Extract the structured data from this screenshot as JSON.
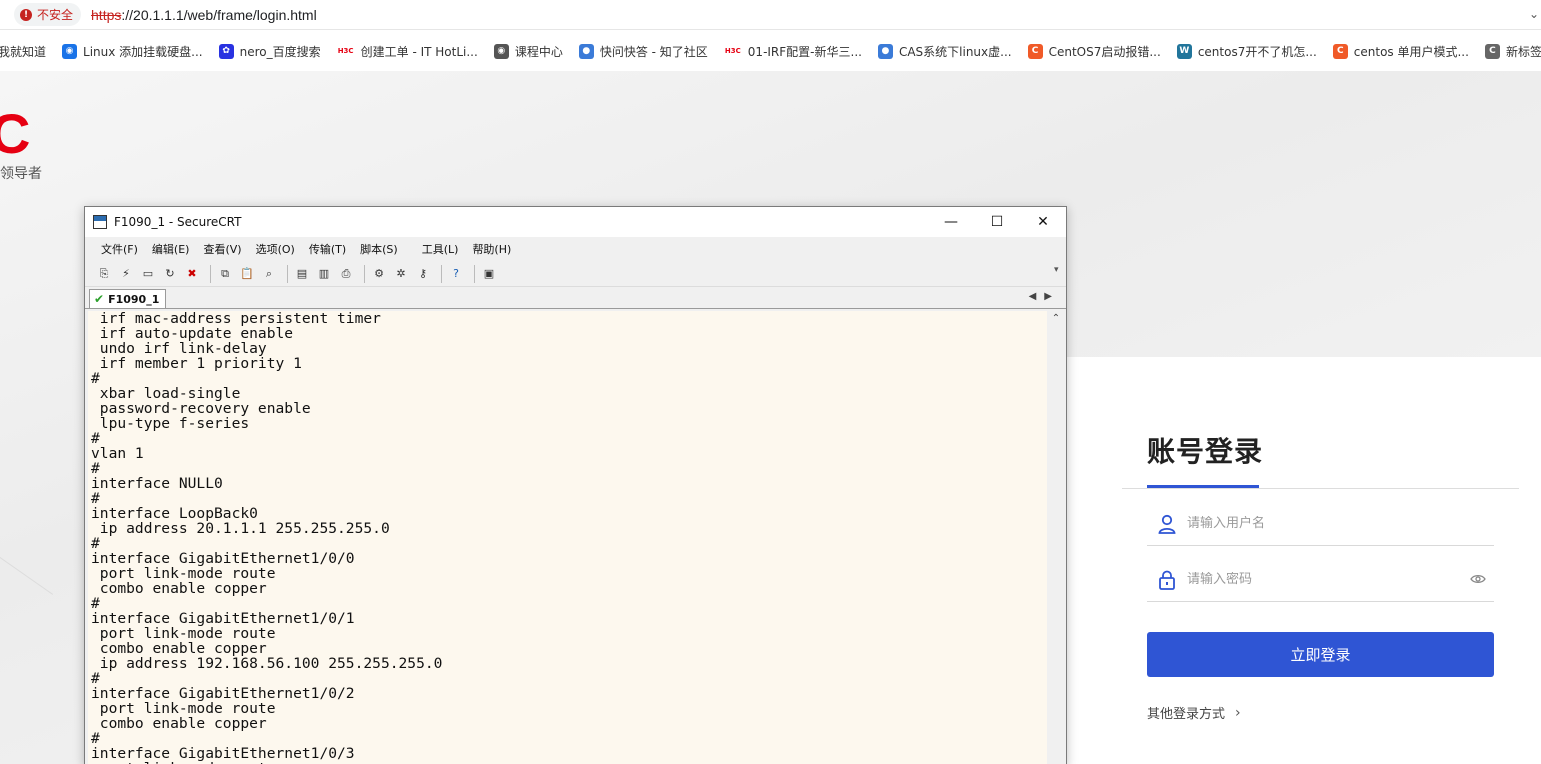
{
  "browser": {
    "security_label": "不安全",
    "url_scheme": "https",
    "url_rest": "://20.1.1.1/web/frame/login.html",
    "bookmarks": [
      {
        "label": "我就知道",
        "icon": "none",
        "color": "#ffffff"
      },
      {
        "label": "Linux 添加挂载硬盘...",
        "icon": "globe-icon",
        "color": "#1a73e8"
      },
      {
        "label": "nero_百度搜索",
        "icon": "paw-icon",
        "color": "#2932e1"
      },
      {
        "label": "创建工单 - IT HotLi...",
        "icon": "h3c-icon",
        "color": "#e60012"
      },
      {
        "label": "课程中心",
        "icon": "globe-icon",
        "color": "#555555"
      },
      {
        "label": "快问快答 - 知了社区",
        "icon": "drop-icon",
        "color": "#3b7bd8"
      },
      {
        "label": "01-IRF配置-新华三...",
        "icon": "h3c-icon",
        "color": "#e60012"
      },
      {
        "label": "CAS系统下linux虚...",
        "icon": "drop-icon",
        "color": "#3b7bd8"
      },
      {
        "label": "CentOS7启动报错...",
        "icon": "c-icon",
        "color": "#f05a28"
      },
      {
        "label": "centos7开不了机怎...",
        "icon": "wordpress-icon",
        "color": "#21759b"
      },
      {
        "label": "centos 单用户模式...",
        "icon": "c-icon",
        "color": "#f05a28"
      },
      {
        "label": "新标签",
        "icon": "c-icon",
        "color": "#666666"
      }
    ]
  },
  "page": {
    "brand_letter": "C",
    "brand_slogan": "领导者",
    "login": {
      "title": "账号登录",
      "username_placeholder": "请输入用户名",
      "password_placeholder": "请输入密码",
      "submit_label": "立即登录",
      "other_methods_label": "其他登录方式"
    }
  },
  "securecrt": {
    "title": "F1090_1 - SecureCRT",
    "menu": [
      "文件(F)",
      "编辑(E)",
      "查看(V)",
      "选项(O)",
      "传输(T)",
      "脚本(S)",
      "工具(L)",
      "帮助(H)"
    ],
    "tab_label": "F1090_1",
    "terminal_lines": [
      " irf mac-address persistent timer",
      " irf auto-update enable",
      " undo irf link-delay",
      " irf member 1 priority 1",
      "#",
      " xbar load-single",
      " password-recovery enable",
      " lpu-type f-series",
      "#",
      "vlan 1",
      "#",
      "interface NULL0",
      "#",
      "interface LoopBack0",
      " ip address 20.1.1.1 255.255.255.0",
      "#",
      "interface GigabitEthernet1/0/0",
      " port link-mode route",
      " combo enable copper",
      "#",
      "interface GigabitEthernet1/0/1",
      " port link-mode route",
      " combo enable copper",
      " ip address 192.168.56.100 255.255.255.0",
      "#",
      "interface GigabitEthernet1/0/2",
      " port link-mode route",
      " combo enable copper",
      "#",
      "interface GigabitEthernet1/0/3",
      " port link-mode route"
    ]
  },
  "colors": {
    "accent": "#2f55d4",
    "brand_red": "#e60012",
    "terminal_bg": "#fdf8ee"
  }
}
